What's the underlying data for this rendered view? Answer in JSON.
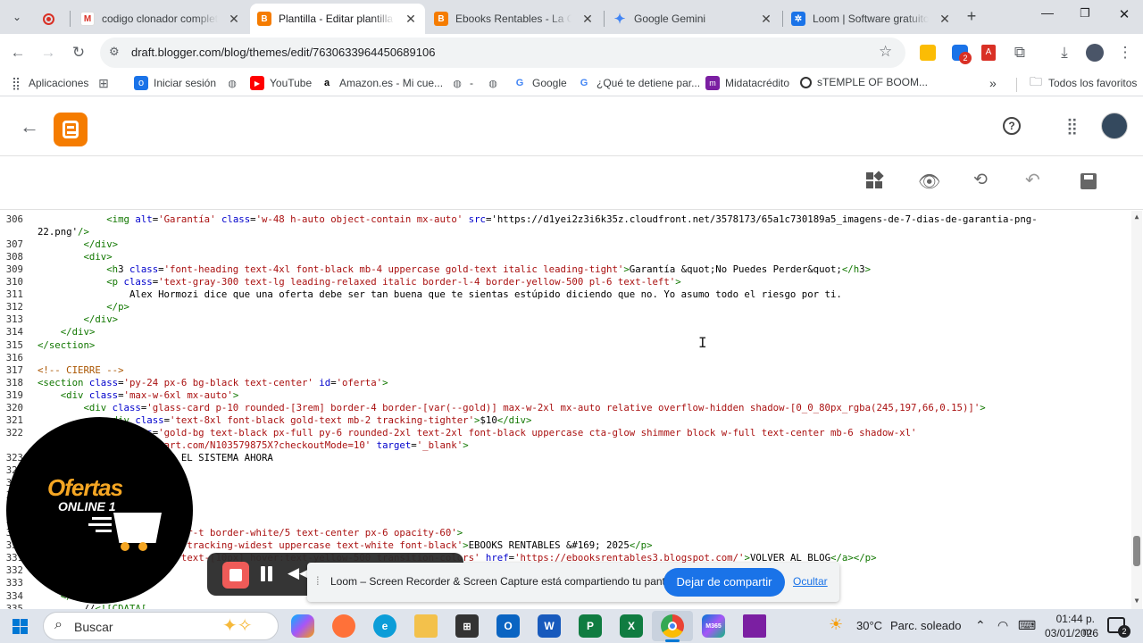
{
  "tabs": [
    {
      "label": "",
      "icon": "record-icon"
    },
    {
      "label": "codigo clonador completo",
      "icon": "gmail-icon"
    },
    {
      "label": "Plantilla - Editar plantilla",
      "icon": "blogger-icon"
    },
    {
      "label": "Ebooks Rentables - La Ofer",
      "icon": "blogger-icon"
    },
    {
      "label": "Google Gemini",
      "icon": "gemini-icon"
    },
    {
      "label": "Loom | Software gratuito d",
      "icon": "loom-icon"
    }
  ],
  "address_bar": {
    "url": "draft.blogger.com/blog/themes/edit/7630633964450689106"
  },
  "bookmarks": [
    {
      "label": "Aplicaciones"
    },
    {
      "label": "Iniciar sesión"
    },
    {
      "label": "YouTube"
    },
    {
      "label": "Amazon.es - Mi cue..."
    },
    {
      "label": "-"
    },
    {
      "label": "Google"
    },
    {
      "label": "¿Qué te detiene par..."
    },
    {
      "label": "Midatacrédito"
    },
    {
      "label": "sTEMPLE OF BOOM..."
    },
    {
      "label": "Todos los favoritos"
    }
  ],
  "extensions_badge": "2",
  "code_lines": [
    {
      "n": "306",
      "t": "            <img alt='Garantía' class='w-48 h-auto object-contain mx-auto' src='https://d1yei2z3i6k35z.cloudfront.net/3578173/65a1c730189a5_imagens-de-7-dias-de-garantia-png-"
    },
    {
      "n": "",
      "t": "22.png'/>"
    },
    {
      "n": "307",
      "t": "        </div>"
    },
    {
      "n": "308",
      "t": "        <div>"
    },
    {
      "n": "309",
      "t": "            <h3 class='font-heading text-4xl font-black mb-4 uppercase gold-text italic leading-tight'>Garantía &quot;No Puedes Perder&quot;</h3>"
    },
    {
      "n": "310",
      "t": "            <p class='text-gray-300 text-lg leading-relaxed italic border-l-4 border-yellow-500 pl-6 text-left'>"
    },
    {
      "n": "311",
      "t": "                Alex Hormozi dice que una oferta debe ser tan buena que te sientas estúpido diciendo que no. Yo asumo todo el riesgo por ti."
    },
    {
      "n": "312",
      "t": "            </p>"
    },
    {
      "n": "313",
      "t": "        </div>"
    },
    {
      "n": "314",
      "t": "    </div>"
    },
    {
      "n": "315",
      "t": "</section>"
    },
    {
      "n": "316",
      "t": ""
    },
    {
      "n": "317",
      "t": "<!-- CIERRE -->"
    },
    {
      "n": "318",
      "t": "<section class='py-24 px-6 bg-black text-center' id='oferta'>"
    },
    {
      "n": "319",
      "t": "    <div class='max-w-6xl mx-auto'>"
    },
    {
      "n": "320",
      "t": "        <div class='glass-card p-10 rounded-[3rem] border-4 border-[var(--gold)] max-w-2xl mx-auto relative overflow-hidden shadow-[0_0_80px_rgba(245,197,66,0.15)]'>"
    },
    {
      "n": "321",
      "t": "            <div class='text-8xl font-black gold-text mb-2 tracking-tighter'>$10</div>"
    },
    {
      "n": "322",
      "t": "            <a class='gold-bg text-black px-full py-6 rounded-2xl text-2xl font-black uppercase cta-glow shimmer block w-full text-center mb-6 shadow-xl'"
    },
    {
      "n": "",
      "t": "href='https://pay.hotmart.com/N103579875X?checkoutMode=10' target='_blank'>"
    },
    {
      "n": "323",
      "t": "                ADQUIRIR EL SISTEMA AHORA"
    },
    {
      "n": "324",
      "t": ""
    },
    {
      "n": "325",
      "t": ""
    },
    {
      "n": "326",
      "t": ""
    },
    {
      "n": "327",
      "t": ""
    },
    {
      "n": "328",
      "t": ""
    },
    {
      "n": "329",
      "t": "<footer class='py-12 border-t border-white/5 text-center px-6 opacity-60'>"
    },
    {
      "n": "330",
      "t": "    <p class='text-[10px] tracking-widest uppercase text-white font-black'>EBOOKS RENTABLES &#169; 2025</p>"
    },
    {
      "n": "331",
      "t": "    <a class='mt-4 block text-[10px] hover:text-yellow-500 transition-colors' href='https://ebooksrentables3.blogspot.com/'>VOLVER AL BLOG</a></p>"
    },
    {
      "n": "332",
      "t": "</footer>"
    },
    {
      "n": "333",
      "t": ""
    },
    {
      "n": "334",
      "t": "    </b:if>"
    },
    {
      "n": "335",
      "t": "        //<![CDATA["
    }
  ],
  "loom": {
    "bubble_line1": "Ofertas",
    "bubble_line2": "ONLINE 1",
    "share_text": "Loom – Screen Recorder & Screen Capture está compartiendo tu pantalla.",
    "stop_button": "Dejar de compartir",
    "hide_link": "Ocultar"
  },
  "taskbar": {
    "search_placeholder": "Buscar",
    "weather_temp": "30°C",
    "weather_desc": "Parc. soleado",
    "time": "01:44 p. m.",
    "date": "03/01/2026",
    "notif_count": "2"
  },
  "colors": {
    "blogger_orange": "#f57c00",
    "loom_blue": "#1a73e8",
    "stop_red": "#ef5350"
  }
}
